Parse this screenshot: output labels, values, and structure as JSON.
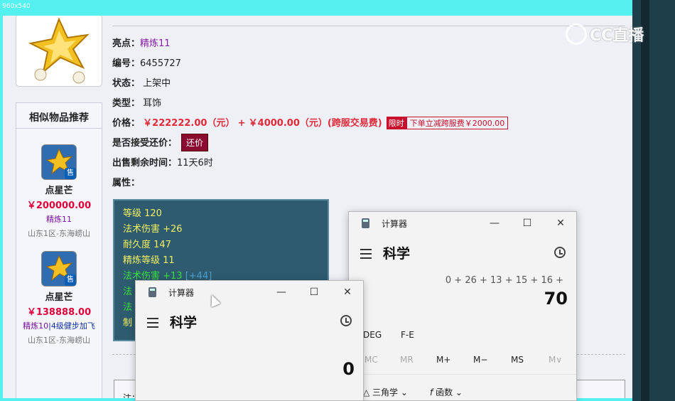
{
  "screen": {
    "resolution_label": "960x540"
  },
  "watermark": {
    "text": "CC直播"
  },
  "sidebar": {
    "title": "相似物品推荐",
    "items": [
      {
        "name": "点星芒",
        "price": "￥200000.00",
        "tag": "精炼11",
        "tag_extra": "",
        "server": "山东1区-东海崂山",
        "sold_badge": "售"
      },
      {
        "name": "点星芒",
        "price": "￥138888.00",
        "tag": "精炼10",
        "tag_extra": "|4级健步加飞",
        "server": "山东1区-东海崂山",
        "sold_badge": "售"
      }
    ]
  },
  "details": {
    "highlight_label": "亮点：",
    "highlight_value": "精炼11",
    "id_label": "编号：",
    "id_value": "6455727",
    "status_label": "状态：",
    "status_value": "上架中",
    "type_label": "类型：",
    "type_value": "耳饰",
    "price_label": "价格：",
    "price_main": "￥222222.00（元）",
    "price_plus": "+",
    "price_fee": "￥4000.00（元）(跨服交易费)",
    "limit_badge": "限时",
    "discount_note": "下单立减跨服费￥2000.00",
    "haggle_label": "是否接受还价：",
    "haggle_button": "还价",
    "remaining_label": "出售剩余时间：",
    "remaining_value": "11天6时",
    "attr_label": "属性："
  },
  "attributes": [
    {
      "text": "等级 120",
      "color": "#f2f060"
    },
    {
      "text": "法术伤害 +26",
      "color": "#f2f060"
    },
    {
      "text": "耐久度 147",
      "color": "#f2f060"
    },
    {
      "text": "精炼等级 11",
      "color": "#f2f060"
    },
    {
      "text": "法术伤害 +13",
      "extra": "[+44]",
      "color": "#3ae03a"
    },
    {
      "text": "法",
      "color": "#3ae03a"
    },
    {
      "text": "法",
      "color": "#3ae03a"
    },
    {
      "text": "制",
      "color": "#f2f060"
    }
  ],
  "note": {
    "label": "注："
  },
  "calc_back": {
    "title": "计算器",
    "mode": "科学",
    "expression": "0 + 26 + 13 + 15 + 16 +",
    "result": "70",
    "row1": [
      "DEG",
      "F-E"
    ],
    "memory": [
      "MC",
      "MR",
      "M+",
      "M−",
      "MS",
      "M∨"
    ],
    "funcs": [
      "三角学",
      "函数"
    ],
    "controls": {
      "minimize": "—",
      "maximize": "☐",
      "close": "✕"
    }
  },
  "calc_front": {
    "title": "计算器",
    "mode": "科学",
    "result": "0",
    "controls": {
      "minimize": "—",
      "maximize": "☐",
      "close": "✕"
    }
  }
}
